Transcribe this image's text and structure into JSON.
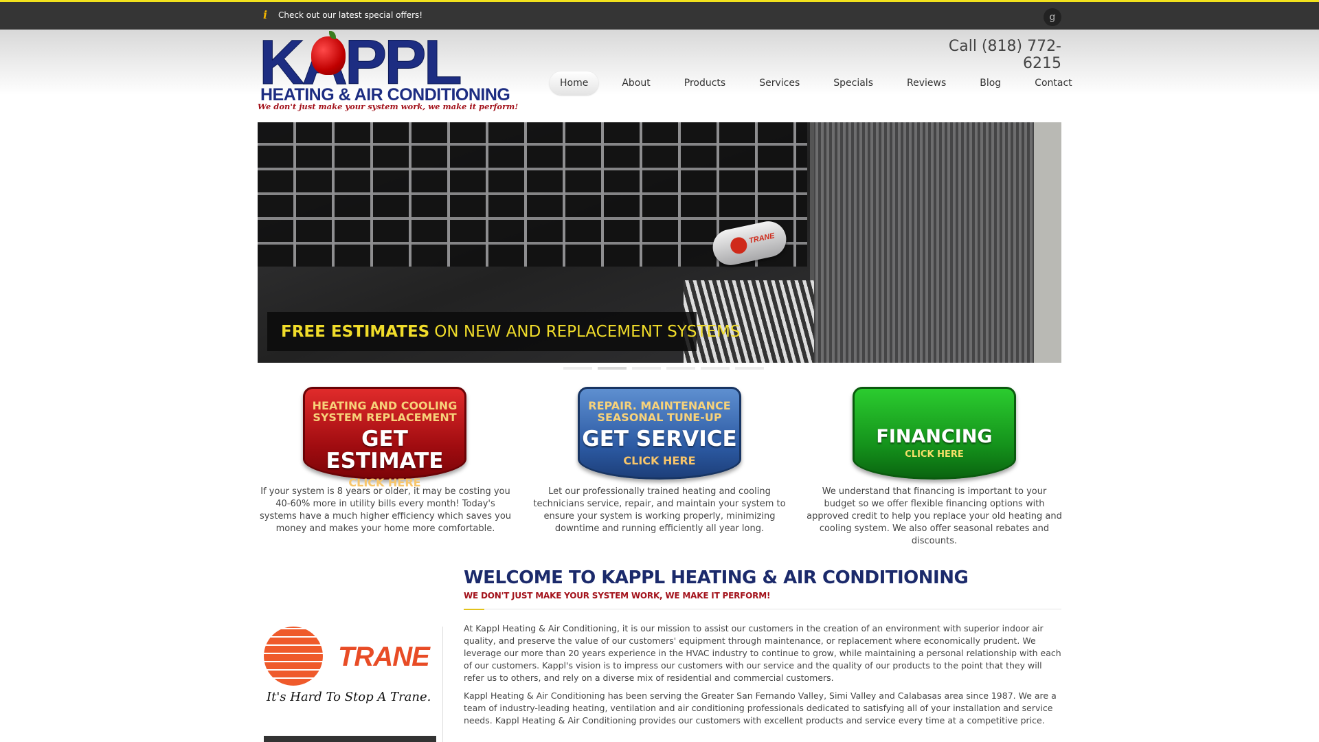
{
  "topbar": {
    "offer_text": "Check out our latest special offers!",
    "offer_icon": "info-icon",
    "social_icon": "google-plus-icon",
    "social_glyph": "g",
    "accent_color": "#f2e21d"
  },
  "header": {
    "logo": {
      "brand": "KAPPL",
      "subtitle": "HEATING & AIR CONDITIONING",
      "tagline": "We don't just make your system work, we make it perform!"
    },
    "phone": "Call (818) 772-6215",
    "nav": [
      "Home",
      "About",
      "Products",
      "Services",
      "Specials",
      "Reviews",
      "Blog",
      "Contact"
    ],
    "active_nav": "Home"
  },
  "hero": {
    "caption_strong": "FREE ESTIMATES",
    "caption_rest": "ON NEW AND REPLACEMENT SYSTEMS",
    "badge_text": "TRANE",
    "slide_count": 6,
    "active_slide": 2
  },
  "cta": [
    {
      "line1": "HEATING AND COOLING",
      "line2": "SYSTEM REPLACEMENT",
      "big": "GET ESTIMATE",
      "click": "CLICK HERE",
      "color": "#a00c10",
      "text": "If your system is 8 years or older, it may be costing you 40-60% more in utility bills every month!  Today's systems have a much higher efficiency which saves you money and makes your home more comfortable."
    },
    {
      "line1": "REPAIR. MAINTENANCE",
      "line2": "SEASONAL TUNE-UP",
      "big": "GET SERVICE",
      "click": "CLICK HERE",
      "color": "#2c5aa3",
      "text": "Let our professionally trained heating and cooling technicians service, repair, and maintain your system to ensure your system is working properly, minimizing downtime and running efficiently all year long."
    },
    {
      "big": "FINANCING",
      "click": "CLICK HERE",
      "color": "#14911b",
      "text": "We understand that financing is important to your budget so we offer flexible financing options with approved credit to help you replace your old heating and cooling system.  We also offer seasonal rebates and discounts."
    }
  ],
  "sidebar": {
    "trane_word": "TRANE",
    "trane_slogan": "It's Hard To Stop A Trane."
  },
  "main": {
    "title": "WELCOME TO KAPPL HEATING & AIR CONDITIONING",
    "subtitle": "WE DON'T JUST MAKE YOUR SYSTEM WORK, WE MAKE IT PERFORM!",
    "paragraphs": [
      "At Kappl Heating & Air Conditioning, it is our mission to assist our customers in the creation of an environment with superior indoor air quality, and preserve the value of our customers' equipment through maintenance, or replacement where economically prudent.  We leverage our more than 20 years experience in the HVAC industry to continue to grow, while maintaining a personal relationship with each of our customers. Kappl's vision is to impress our customers with our service and the quality of our products to the point that they will refer us to others, and rely on a diverse mix of residential and commercial customers.",
      "Kappl Heating & Air Conditioning has been serving the Greater San Fernando Valley, Simi Valley and Calabasas area since 1987. We are a team of industry-leading heating, ventilation and air conditioning professionals dedicated to satisfying all of your installation and service needs. Kappl Heating & Air Conditioning provides our customers with excellent products and service every time at a competitive price."
    ]
  }
}
